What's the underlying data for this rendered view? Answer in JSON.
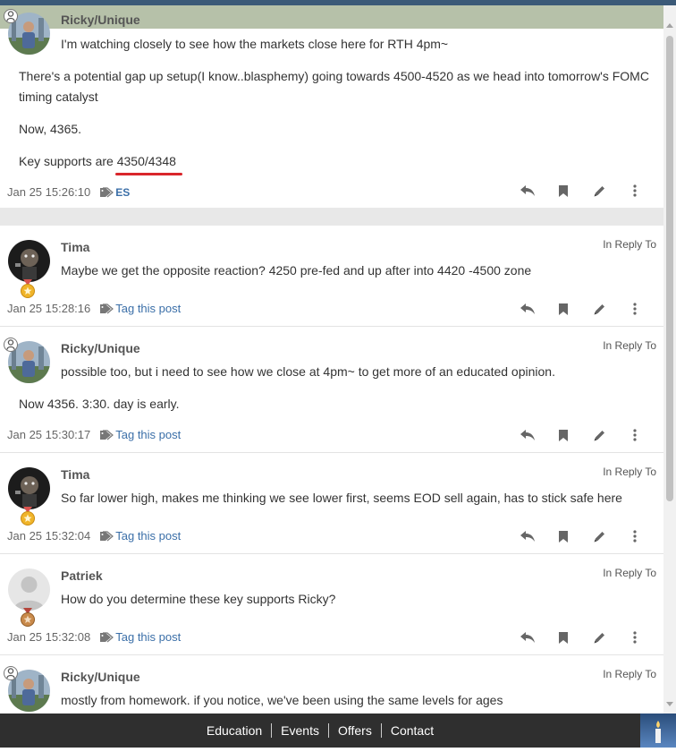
{
  "posts": [
    {
      "author": "Ricky/Unique",
      "line1": "I'm watching closely to see how the markets close here for RTH 4pm~",
      "para1": "There's a potential gap up setup(I know..blasphemy) going towards 4500-4520 as we head into tomorrow's FOMC",
      "para1b": "timing catalyst",
      "para2": "Now, 4365.",
      "para3_prefix": "Key supports are ",
      "para3_value": "4350/4348",
      "timestamp": "Jan 25 15:26:10",
      "tag": "ES"
    },
    {
      "author": "Tima",
      "reply_to": "In Reply To",
      "line1": "Maybe we get the opposite reaction? 4250 pre-fed and up after into 4420 -4500 zone",
      "timestamp": "Jan 25 15:28:16",
      "tag_link": "Tag this post"
    },
    {
      "author": "Ricky/Unique",
      "reply_to": "In Reply To",
      "line1": "possible too, but i need to see how we close at 4pm~ to get more of an educated opinion.",
      "para1": "Now 4356. 3:30. day is early.",
      "timestamp": "Jan 25 15:30:17",
      "tag_link": "Tag this post"
    },
    {
      "author": "Tima",
      "reply_to": "In Reply To",
      "line1": "So far lower high, makes me thinking we see lower first, seems EOD sell again, has to stick safe here",
      "timestamp": "Jan 25 15:32:04",
      "tag_link": "Tag this post"
    },
    {
      "author": "Patriek",
      "reply_to": "In Reply To",
      "line1": "How do you determine these key supports Ricky?",
      "timestamp": "Jan 25 15:32:08",
      "tag_link": "Tag this post"
    },
    {
      "author": "Ricky/Unique",
      "reply_to": "In Reply To",
      "line1": "mostly from homework. if you notice, we've been using the same levels for ages"
    }
  ],
  "footer": {
    "links": [
      "Education",
      "Events",
      "Offers",
      "Contact"
    ]
  },
  "icons": {
    "reply": "reply-icon",
    "bookmark": "bookmark-icon",
    "edit": "pencil-icon",
    "more": "more-vertical-icon",
    "tag": "tag-icon",
    "medal": "medal-icon",
    "person": "person-icon",
    "candle": "candle-icon"
  },
  "colors": {
    "name_band": "#b6c1a9",
    "link": "#3b6fa8",
    "highlight_underline": "#d9262b",
    "footer": "#2f2f2f",
    "topbar": "#3b5a78"
  }
}
